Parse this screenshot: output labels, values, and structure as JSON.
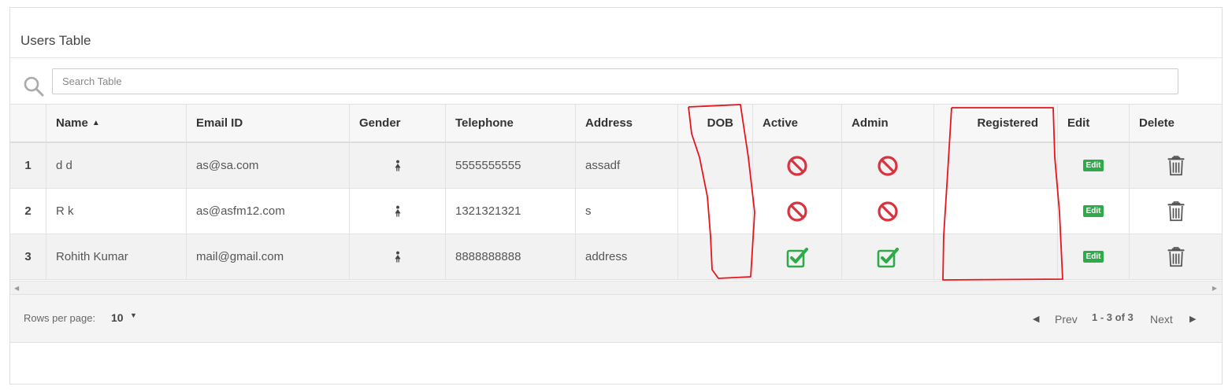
{
  "card": {
    "title": "Users Table"
  },
  "search": {
    "placeholder": "Search Table",
    "value": ""
  },
  "table": {
    "headers": [
      "",
      "Name",
      "Email ID",
      "Gender",
      "Telephone",
      "Address",
      "DOB",
      "Active",
      "Admin",
      "Registered",
      "Edit",
      "Delete"
    ],
    "sort": {
      "column": "Name",
      "direction": "ascending",
      "icon": "sort-asc-icon"
    },
    "rows": [
      {
        "num": "1",
        "name": "d d",
        "email": "as@sa.com",
        "gender": "female",
        "telephone": "5555555555",
        "address": "assadf",
        "dob": "",
        "active": false,
        "admin": false,
        "registered": "",
        "edit": "Edit"
      },
      {
        "num": "2",
        "name": "R k",
        "email": "as@asfm12.com",
        "gender": "female",
        "telephone": "1321321321",
        "address": "s",
        "dob": "",
        "active": false,
        "admin": false,
        "registered": "",
        "edit": "Edit"
      },
      {
        "num": "3",
        "name": "Rohith Kumar",
        "email": "mail@gmail.com",
        "gender": "female",
        "telephone": "8888888888",
        "address": "address",
        "dob": "",
        "active": true,
        "admin": true,
        "registered": "",
        "edit": "Edit"
      }
    ]
  },
  "icons": {
    "search": "search-icon",
    "gender": "female-icon",
    "inactive": "prohibited-icon",
    "active": "checkbox-checked-icon",
    "delete": "trash-icon"
  },
  "colors": {
    "inactive": "#d9333f",
    "active": "#2eaa4a",
    "edit_badge": "#2eaa4a",
    "annotation": "#e8141b"
  },
  "footer": {
    "rows_per_page_label": "Rows per page:",
    "rows_per_page_value": "10",
    "prev_label": "Prev",
    "range_label": "1 - 3 of 3",
    "next_label": "Next"
  }
}
